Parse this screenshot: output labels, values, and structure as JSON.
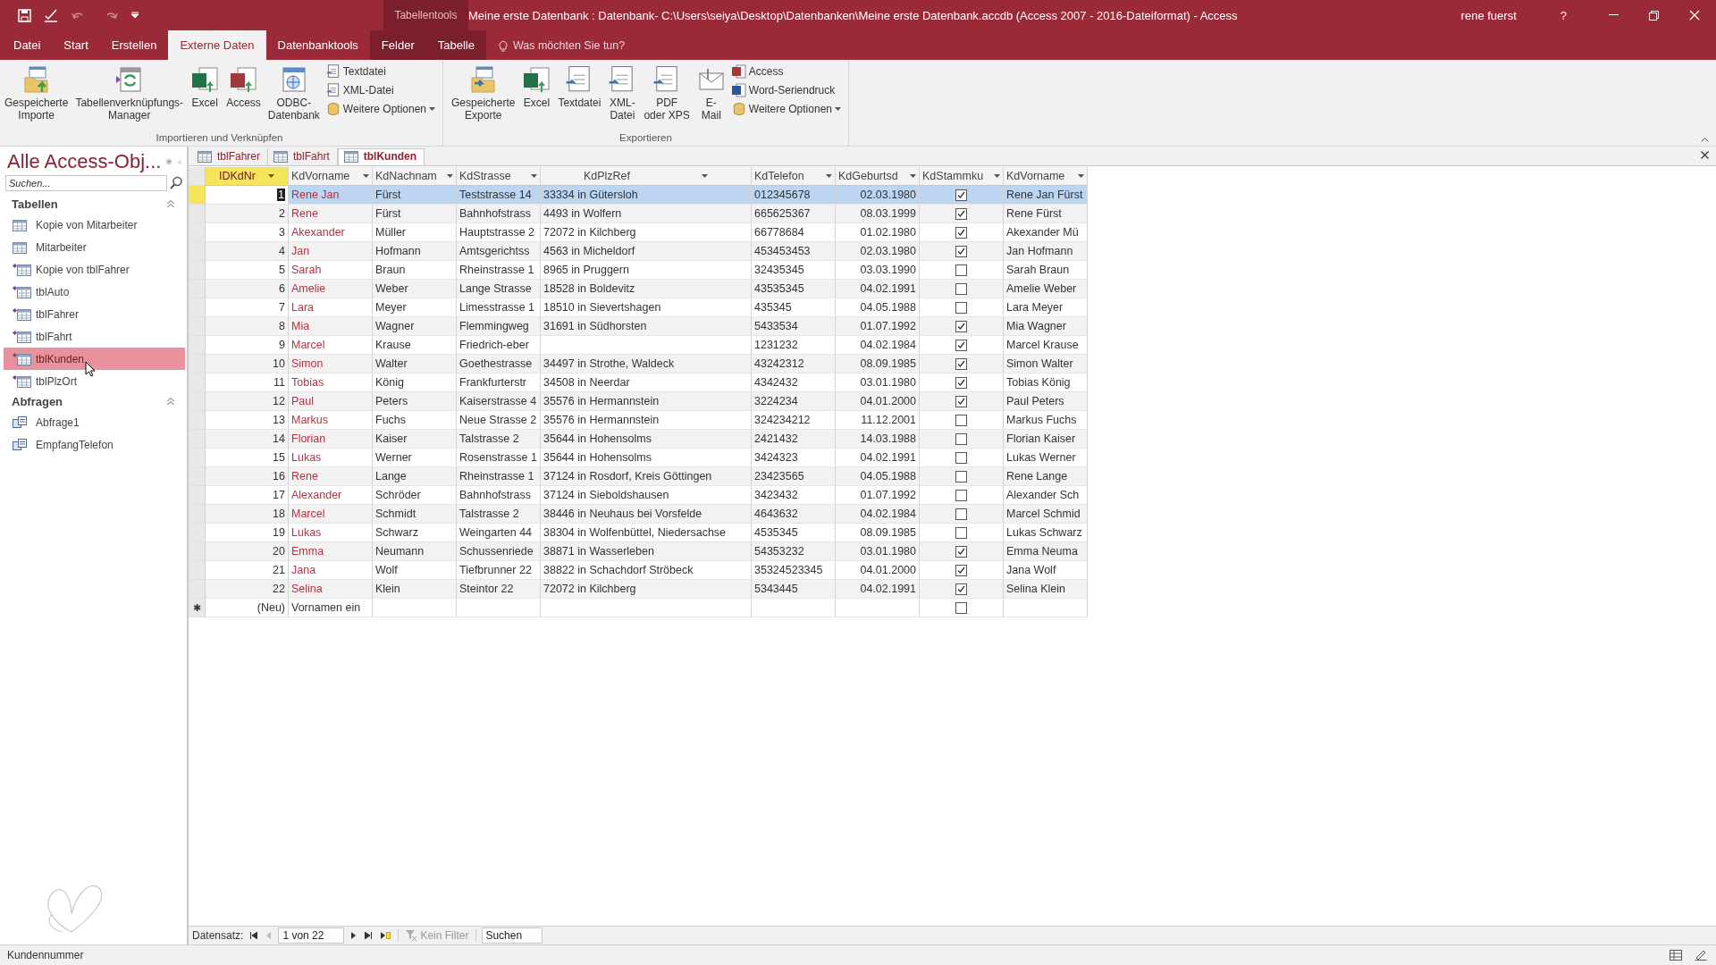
{
  "title_bar": {
    "context_label": "Tabellentools",
    "title": "Meine erste Datenbank : Datenbank- C:\\Users\\seiya\\Desktop\\Datenbanken\\Meine erste Datenbank.accdb (Access 2007 - 2016-Dateiformat)  -  Access",
    "user": "rene fuerst",
    "help": "?"
  },
  "ribbon_tabs": [
    {
      "label": "Datei",
      "selected": false,
      "kind": "normal"
    },
    {
      "label": "Start",
      "selected": false,
      "kind": "normal"
    },
    {
      "label": "Erstellen",
      "selected": false,
      "kind": "normal"
    },
    {
      "label": "Externe Daten",
      "selected": true,
      "kind": "normal"
    },
    {
      "label": "Datenbanktools",
      "selected": false,
      "kind": "normal"
    },
    {
      "label": "Felder",
      "selected": false,
      "kind": "contextual"
    },
    {
      "label": "Tabelle",
      "selected": false,
      "kind": "contextual"
    }
  ],
  "tell_me": {
    "placeholder": "Was möchten Sie tun?"
  },
  "ribbon_groups": [
    {
      "label": "Importieren und Verknüpfen",
      "buttons": [
        {
          "kind": "large",
          "lines": [
            "Gespeicherte",
            "Importe"
          ]
        },
        {
          "kind": "large",
          "lines": [
            "Tabellenverknüpfungs-",
            "Manager"
          ]
        },
        {
          "kind": "large",
          "lines": [
            "Excel"
          ]
        },
        {
          "kind": "large",
          "lines": [
            "Access"
          ]
        },
        {
          "kind": "large",
          "lines": [
            "ODBC-",
            "Datenbank"
          ]
        },
        {
          "kind": "stack",
          "items": [
            {
              "label": "Textdatei",
              "dropdown": false
            },
            {
              "label": "XML-Datei",
              "dropdown": false
            },
            {
              "label": "Weitere Optionen",
              "dropdown": true
            }
          ]
        }
      ]
    },
    {
      "label": "Exportieren",
      "buttons": [
        {
          "kind": "large",
          "lines": [
            "Gespeicherte",
            "Exporte"
          ]
        },
        {
          "kind": "large",
          "lines": [
            "Excel"
          ]
        },
        {
          "kind": "large",
          "lines": [
            "Textdatei"
          ]
        },
        {
          "kind": "large",
          "lines": [
            "XML-",
            "Datei"
          ]
        },
        {
          "kind": "large",
          "lines": [
            "PDF",
            "oder XPS"
          ]
        },
        {
          "kind": "large",
          "lines": [
            "E-",
            "Mail"
          ]
        },
        {
          "kind": "stack",
          "items": [
            {
              "label": "Access",
              "dropdown": false
            },
            {
              "label": "Word-Seriendruck",
              "dropdown": false
            },
            {
              "label": "Weitere Optionen",
              "dropdown": true
            }
          ]
        }
      ]
    }
  ],
  "nav_pane": {
    "title": "Alle Access-Obj...",
    "search": {
      "placeholder": "Suchen..."
    },
    "groups": [
      {
        "label": "Tabellen",
        "items": [
          {
            "label": "Kopie von Mitarbeiter",
            "kind": "table",
            "selected": false
          },
          {
            "label": "Mitarbeiter",
            "kind": "table",
            "selected": false
          },
          {
            "label": "Kopie von tblFahrer",
            "kind": "linked_table",
            "selected": false
          },
          {
            "label": "tblAuto",
            "kind": "linked_table",
            "selected": false
          },
          {
            "label": "tblFahrer",
            "kind": "linked_table",
            "selected": false
          },
          {
            "label": "tblFahrt",
            "kind": "linked_table",
            "selected": false
          },
          {
            "label": "tblKunden",
            "kind": "linked_table",
            "selected": true
          },
          {
            "label": "tblPlzOrt",
            "kind": "linked_table",
            "selected": false
          }
        ]
      },
      {
        "label": "Abfragen",
        "items": [
          {
            "label": "Abfrage1",
            "kind": "query",
            "selected": false
          },
          {
            "label": "EmpfangTelefon",
            "kind": "query",
            "selected": false
          }
        ]
      }
    ]
  },
  "document_tabs": [
    {
      "label": "tblFahrer",
      "selected": false
    },
    {
      "label": "tblFahrt",
      "selected": false
    },
    {
      "label": "tblKunden",
      "selected": true
    }
  ],
  "table": {
    "columns": [
      {
        "label": "IDKdNr",
        "kind": "number",
        "selected": true
      },
      {
        "label": "KdVorname",
        "kind": "name",
        "selected": false
      },
      {
        "label": "KdNachnam",
        "kind": "text",
        "selected": false
      },
      {
        "label": "KdStrasse",
        "kind": "text",
        "selected": false
      },
      {
        "label": "KdPlzRef",
        "kind": "wide",
        "selected": false
      },
      {
        "label": "KdTelefon",
        "kind": "text",
        "selected": false
      },
      {
        "label": "KdGeburtsd",
        "kind": "date",
        "selected": false
      },
      {
        "label": "KdStammku",
        "kind": "check",
        "selected": false
      },
      {
        "label": "KdVorname",
        "kind": "text",
        "selected": false
      }
    ],
    "rows": [
      {
        "selected": true,
        "checked": true,
        "cells": [
          "1",
          "Rene Jan",
          "Fürst",
          "Teststrasse 14",
          "33334 in Gütersloh",
          "012345678",
          "02.03.1980",
          "Rene Jan Fürst"
        ]
      },
      {
        "selected": false,
        "checked": true,
        "cells": [
          "2",
          "Rene",
          "Fürst",
          "Bahnhofstrass",
          "4493 in Wolfern",
          "665625367",
          "08.03.1999",
          "Rene Fürst"
        ]
      },
      {
        "selected": false,
        "checked": true,
        "cells": [
          "3",
          "Akexander",
          "Müller",
          "Hauptstrasse 2",
          "72072 in Kilchberg",
          "66778684",
          "01.02.1980",
          "Akexander Mü"
        ]
      },
      {
        "selected": false,
        "checked": true,
        "cells": [
          "4",
          "Jan",
          "Hofmann",
          "Amtsgerichtss",
          "4563 in Micheldorf",
          "453453453",
          "02.03.1980",
          "Jan Hofmann"
        ]
      },
      {
        "selected": false,
        "checked": false,
        "cells": [
          "5",
          "Sarah",
          "Braun",
          "Rheinstrasse 1",
          "8965 in Pruggern",
          "32435345",
          "03.03.1990",
          "Sarah Braun"
        ]
      },
      {
        "selected": false,
        "checked": false,
        "cells": [
          "6",
          "Amelie",
          "Weber",
          "Lange Strasse",
          "18528 in Boldevitz",
          "43535345",
          "04.02.1991",
          "Amelie Weber"
        ]
      },
      {
        "selected": false,
        "checked": false,
        "cells": [
          "7",
          "Lara",
          "Meyer",
          "Limesstrasse 1",
          "18510 in Sievertshagen",
          "435345",
          "04.05.1988",
          "Lara Meyer"
        ]
      },
      {
        "selected": false,
        "checked": true,
        "cells": [
          "8",
          "Mia",
          "Wagner",
          "Flemmingweg",
          "31691 in Südhorsten",
          "5433534",
          "01.07.1992",
          "Mia Wagner"
        ]
      },
      {
        "selected": false,
        "checked": true,
        "cells": [
          "9",
          "Marcel",
          "Krause",
          "Friedrich-eber",
          "",
          "1231232",
          "04.02.1984",
          "Marcel Krause"
        ]
      },
      {
        "selected": false,
        "checked": true,
        "cells": [
          "10",
          "Simon",
          "Walter",
          "Goethestrasse",
          "34497 in Strothe, Waldeck",
          "43242312",
          "08.09.1985",
          "Simon Walter"
        ]
      },
      {
        "selected": false,
        "checked": true,
        "cells": [
          "11",
          "Tobias",
          "König",
          "Frankfurterstr",
          "34508 in Neerdar",
          "4342432",
          "03.01.1980",
          "Tobias König"
        ]
      },
      {
        "selected": false,
        "checked": true,
        "cells": [
          "12",
          "Paul",
          "Peters",
          "Kaiserstrasse 4",
          "35576 in Hermannstein",
          "3224234",
          "04.01.2000",
          "Paul Peters"
        ]
      },
      {
        "selected": false,
        "checked": false,
        "cells": [
          "13",
          "Markus",
          "Fuchs",
          "Neue Strasse 2",
          "35576 in Hermannstein",
          "324234212",
          "11.12.2001",
          "Markus Fuchs"
        ]
      },
      {
        "selected": false,
        "checked": false,
        "cells": [
          "14",
          "Florian",
          "Kaiser",
          "Talstrasse 2",
          "35644 in Hohensolms",
          "2421432",
          "14.03.1988",
          "Florian Kaiser"
        ]
      },
      {
        "selected": false,
        "checked": false,
        "cells": [
          "15",
          "Lukas",
          "Werner",
          "Rosenstrasse 1",
          "35644 in Hohensolms",
          "3424323",
          "04.02.1991",
          "Lukas Werner"
        ]
      },
      {
        "selected": false,
        "checked": false,
        "cells": [
          "16",
          "Rene",
          "Lange",
          "Rheinstrasse 1",
          "37124 in Rosdorf, Kreis Göttingen",
          "23423565",
          "04.05.1988",
          "Rene Lange"
        ]
      },
      {
        "selected": false,
        "checked": false,
        "cells": [
          "17",
          "Alexander",
          "Schröder",
          "Bahnhofstrass",
          "37124 in Sieboldshausen",
          "3423432",
          "01.07.1992",
          "Alexander Sch"
        ]
      },
      {
        "selected": false,
        "checked": false,
        "cells": [
          "18",
          "Marcel",
          "Schmidt",
          "Talstrasse 2",
          "38446 in Neuhaus bei Vorsfelde",
          "4643632",
          "04.02.1984",
          "Marcel Schmid"
        ]
      },
      {
        "selected": false,
        "checked": false,
        "cells": [
          "19",
          "Lukas",
          "Schwarz",
          "Weingarten 44",
          "38304 in Wolfenbüttel, Niedersachse",
          "4535345",
          "08.09.1985",
          "Lukas Schwarz"
        ]
      },
      {
        "selected": false,
        "checked": true,
        "cells": [
          "20",
          "Emma",
          "Neumann",
          "Schussenriede",
          "38871 in Wasserleben",
          "54353232",
          "03.01.1980",
          "Emma Neuma"
        ]
      },
      {
        "selected": false,
        "checked": true,
        "cells": [
          "21",
          "Jana",
          "Wolf",
          "Tiefbrunner 22",
          "38822 in Schachdorf Ströbeck",
          "35324523345",
          "04.01.2000",
          "Jana Wolf"
        ]
      },
      {
        "selected": false,
        "checked": true,
        "cells": [
          "22",
          "Selina",
          "Klein",
          "Steintor 22",
          "72072 in Kilchberg",
          "5343445",
          "04.02.1991",
          "Selina Klein"
        ]
      }
    ],
    "new_row": {
      "marker": "✱",
      "id": "(Neu)",
      "first_name": "Vornamen ein",
      "checked": false
    }
  },
  "record_nav": {
    "label": "Datensatz:",
    "position": "1 von 22",
    "filter": "Kein Filter",
    "search": {
      "placeholder": "Suchen"
    }
  },
  "status_bar": {
    "text": "Kundennummer"
  }
}
